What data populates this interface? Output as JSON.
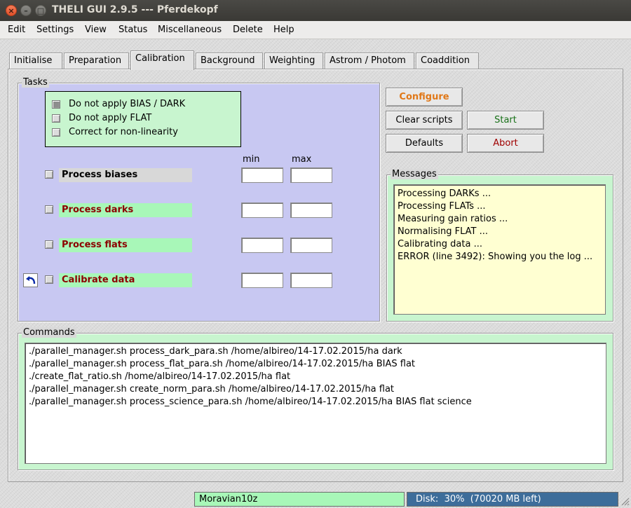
{
  "window": {
    "title": "THELI GUI 2.9.5 --- Pferdekopf"
  },
  "menu": [
    "Edit",
    "Settings",
    "View",
    "Status",
    "Miscellaneous",
    "Delete",
    "Help"
  ],
  "tabs": [
    "Initialise",
    "Preparation",
    "Calibration",
    "Background",
    "Weighting",
    "Astrom / Photom",
    "Coaddition"
  ],
  "active_tab": "Calibration",
  "tasks": {
    "title": "Tasks",
    "options": [
      {
        "label": "Do not apply BIAS / DARK",
        "checked": true
      },
      {
        "label": "Do not apply FLAT",
        "checked": false
      },
      {
        "label": "Correct for non-linearity",
        "checked": false
      }
    ],
    "col_min": "min",
    "col_max": "max",
    "processes": [
      {
        "label": "Process biases",
        "min": "",
        "max": ""
      },
      {
        "label": "Process darks",
        "min": "",
        "max": ""
      },
      {
        "label": "Process flats",
        "min": "",
        "max": ""
      },
      {
        "label": "Calibrate data",
        "min": "",
        "max": ""
      }
    ]
  },
  "buttons": {
    "configure": "Configure",
    "clear_scripts": "Clear scripts",
    "start": "Start",
    "defaults": "Defaults",
    "abort": "Abort"
  },
  "messages": {
    "title": "Messages",
    "lines": [
      "Processing DARKs ...",
      "Processing FLATs ...",
      "Measuring gain ratios ...",
      "Normalising FLAT ...",
      "Calibrating data ...",
      "ERROR (line 3492): Showing you the log ..."
    ]
  },
  "commands": {
    "title": "Commands",
    "lines": [
      "./parallel_manager.sh process_dark_para.sh /home/albireo/14-17.02.2015/ha dark",
      "./parallel_manager.sh process_flat_para.sh /home/albireo/14-17.02.2015/ha BIAS flat",
      "./create_flat_ratio.sh /home/albireo/14-17.02.2015/ha flat",
      "./parallel_manager.sh create_norm_para.sh /home/albireo/14-17.02.2015/ha flat",
      "./parallel_manager.sh process_science_para.sh /home/albireo/14-17.02.2015/ha BIAS flat science"
    ]
  },
  "status": {
    "instrument": "Moravian10z",
    "disk_text": "Disk:  30%  (70020 MB left)",
    "disk_percent": 30
  },
  "colors": {
    "tasks_bg": "#c8c8f2",
    "panel_green": "#c8f5cf",
    "messages_bg": "#ffffd2",
    "configure": "#e07818",
    "start": "#177017",
    "abort": "#a00000",
    "process_red": "#8b0000"
  }
}
